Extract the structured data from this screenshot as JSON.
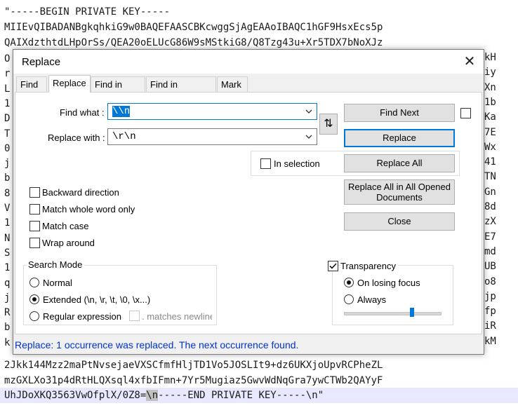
{
  "editor": {
    "lines": [
      "\"-----BEGIN PRIVATE KEY-----",
      "MIIEvQIBADANBgkqhkiG9w0BAQEFAASCBKcwggSjAgEAAoIBAQC1hGF9HsxEcs5p",
      "QAIXdzthtdLHpOrSs/QEA20oELUcG86W9sMStkiG8/Q8Tzg43u+Xr5TDX7bNoXJz"
    ],
    "left_fragments": [
      "O",
      "r",
      "L",
      "1",
      "D",
      "T",
      "0",
      "j",
      "b",
      "8",
      "V",
      "1",
      "N",
      "S",
      "1",
      "q",
      "j",
      "R",
      "b",
      "k"
    ],
    "right_fragments": [
      "kH",
      "iy",
      "Xn",
      "1b",
      "Ka",
      "7E",
      "Wx",
      "41",
      "TN",
      "Gn",
      "8d",
      "zX",
      "E7",
      "md",
      "UB",
      "o8",
      "jp",
      "fp",
      "iR",
      "kM"
    ],
    "bottom_lines": [
      "2Jkk144Mzz2maPtNvsejaeVXSCfmfHljTD1Vo5JOSLIt9+dz6UKXjoUpvRCPheZL",
      "mzGXLXo31p4dRtHLQXsql4xfbIFmn+7Yr5Mugiaz5GwvWdNqGra7ywCTWb2QAYyF"
    ],
    "current_line_prefix": "UhJDoXKQ3563VwOfplX/0Z8=",
    "current_line_match": "\\n",
    "current_line_suffix": "-----END PRIVATE KEY-----\\n\""
  },
  "dialog": {
    "title": "Replace",
    "close_glyph": "✕",
    "tabs": [
      "Find",
      "Replace",
      "Find in Files",
      "Find in Projects",
      "Mark"
    ],
    "find_label": "Find what :",
    "find_value": "\\\\n",
    "replace_label": "Replace with :",
    "replace_value": "\\r\\n",
    "swap_glyph": "⇅",
    "buttons": {
      "find_next": "Find Next",
      "replace": "Replace",
      "replace_all": "Replace All",
      "replace_all_opened_1": "Replace All in All Opened",
      "replace_all_opened_2": "Documents",
      "close": "Close"
    },
    "in_selection": "In selection",
    "options": {
      "backward": "Backward direction",
      "whole_word": "Match whole word only",
      "match_case": "Match case",
      "wrap_around": "Wrap around"
    },
    "search_mode": {
      "title": "Search Mode",
      "normal": "Normal",
      "extended": "Extended (\\n, \\r, \\t, \\0, \\x...)",
      "regex": "Regular expression",
      "matches_newline": ". matches newline",
      "selected": "extended"
    },
    "transparency": {
      "title": "Transparency",
      "checked": true,
      "on_losing_focus": "On losing focus",
      "always": "Always",
      "selected": "on_losing_focus"
    },
    "status": "Replace: 1 occurrence was replaced. The next occurrence found."
  }
}
